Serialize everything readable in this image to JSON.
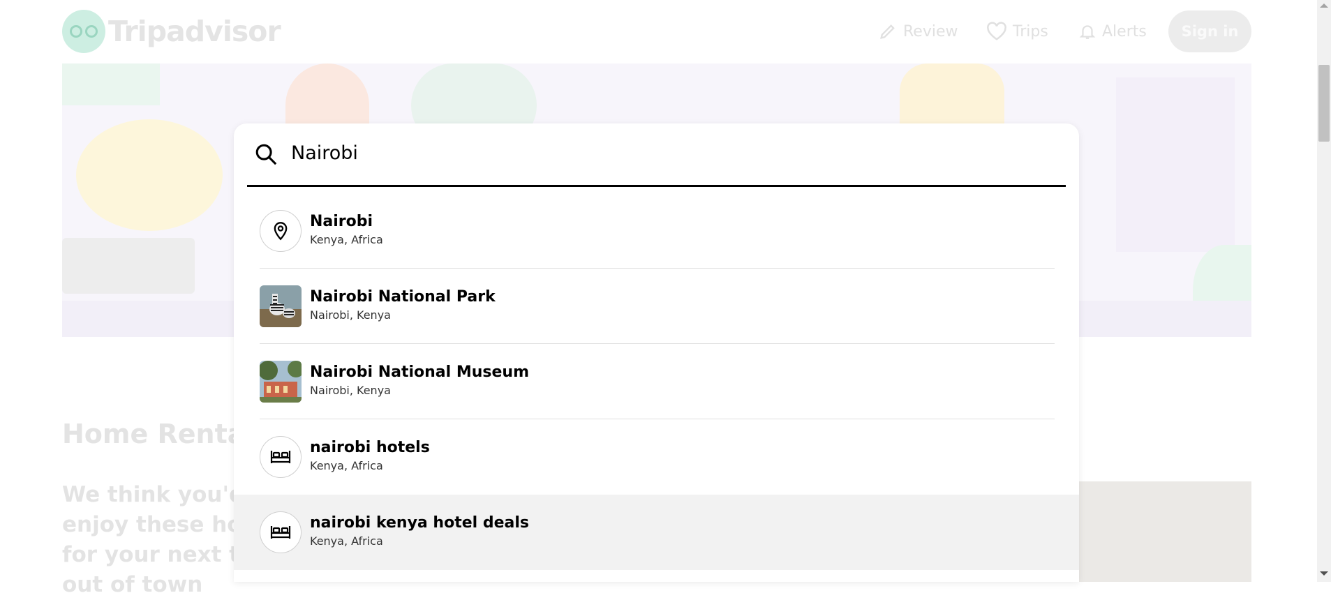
{
  "header": {
    "logo_text": "Tripadvisor",
    "nav": [
      {
        "label": "Review",
        "icon": "pencil-icon"
      },
      {
        "label": "Trips",
        "icon": "heart-icon"
      },
      {
        "label": "Alerts",
        "icon": "bell-icon"
      }
    ],
    "sign_in_label": "Sign in"
  },
  "section": {
    "title": "Home Rentals",
    "subtitle": "We think you'd enjoy these homes for your next trip out of town"
  },
  "search": {
    "value": "Nairobi",
    "icon": "search-icon",
    "results": [
      {
        "title": "Nairobi",
        "subtitle": "Kenya, Africa",
        "icon": "map-pin-icon"
      },
      {
        "title": "Nairobi National Park",
        "subtitle": "Nairobi, Kenya",
        "icon": "zebra-photo"
      },
      {
        "title": "Nairobi National Museum",
        "subtitle": "Nairobi, Kenya",
        "icon": "museum-photo"
      },
      {
        "title": "nairobi hotels",
        "subtitle": "Kenya, Africa",
        "icon": "bed-icon"
      },
      {
        "title": "nairobi kenya hotel deals",
        "subtitle": "Kenya, Africa",
        "icon": "bed-icon"
      }
    ],
    "highlighted_index": 4
  },
  "colors": {
    "accent": "#34e0a1",
    "highlight_bg": "#f2f2f2",
    "text": "#000000"
  }
}
